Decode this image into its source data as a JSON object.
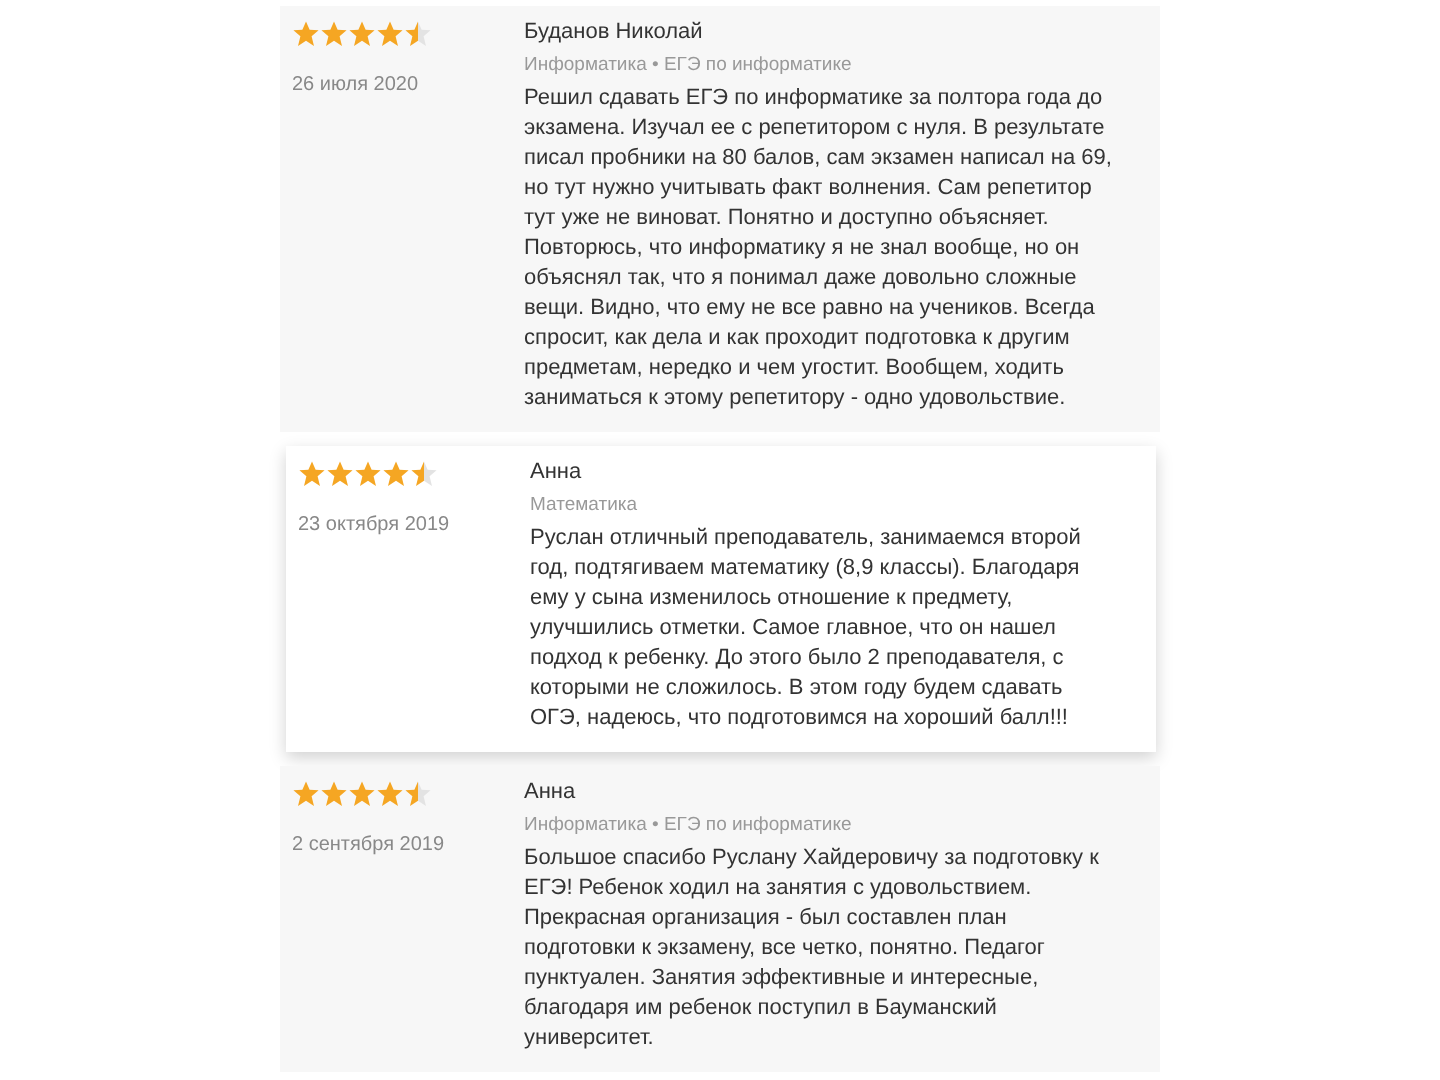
{
  "reviews": [
    {
      "stars": 4.5,
      "date": "26 июля 2020",
      "author": "Буданов Николай",
      "subjects": "Информатика • ЕГЭ по информатике",
      "text": "Решил сдавать ЕГЭ по информатике за полтора года до экзамена. Изучал ее с репетитором с нуля. В результате писал пробники на 80 балов, сам экзамен написал на 69, но тут нужно учитывать факт волнения. Сам репетитор тут уже не виноват. Понятно и доступно объясняет. Повторюсь, что информатику я не знал вообще, но он объяснял так, что я понимал даже довольно сложные вещи. Видно, что ему не все равно на учеников. Всегда спросит, как дела и как проходит подготовка к другим предметам, нередко и чем угостит. Вообщем, ходить заниматься к этому репетитору - одно удовольствие.",
      "selected": false
    },
    {
      "stars": 4.5,
      "date": "23 октября 2019",
      "author": "Анна",
      "subjects": "Математика",
      "text": "Руслан отличный преподаватель, занимаемся второй год, подтягиваем математику (8,9 классы). Благодаря ему у сына изменилось отношение к предмету, улучшились отметки. Самое главное, что он нашел подход к ребенку. До этого было 2 преподавателя, с которыми не сложилось. В этом году будем сдавать ОГЭ, надеюсь, что подготовимся на хороший балл!!!",
      "selected": true
    },
    {
      "stars": 4.5,
      "date": "2 сентября 2019",
      "author": "Анна",
      "subjects": "Информатика • ЕГЭ по информатике",
      "text": "Большое спасибо Руслану Хайдеровичу за подготовку к ЕГЭ! Ребенок ходил на занятия с удовольствием. Прекрасная организация - был составлен план подготовки к экзамену, все четко, понятно. Педагог пунктуален. Занятия эффективные и интересные, благодаря им ребенок поступил в Бауманский университет.",
      "selected": false
    }
  ]
}
